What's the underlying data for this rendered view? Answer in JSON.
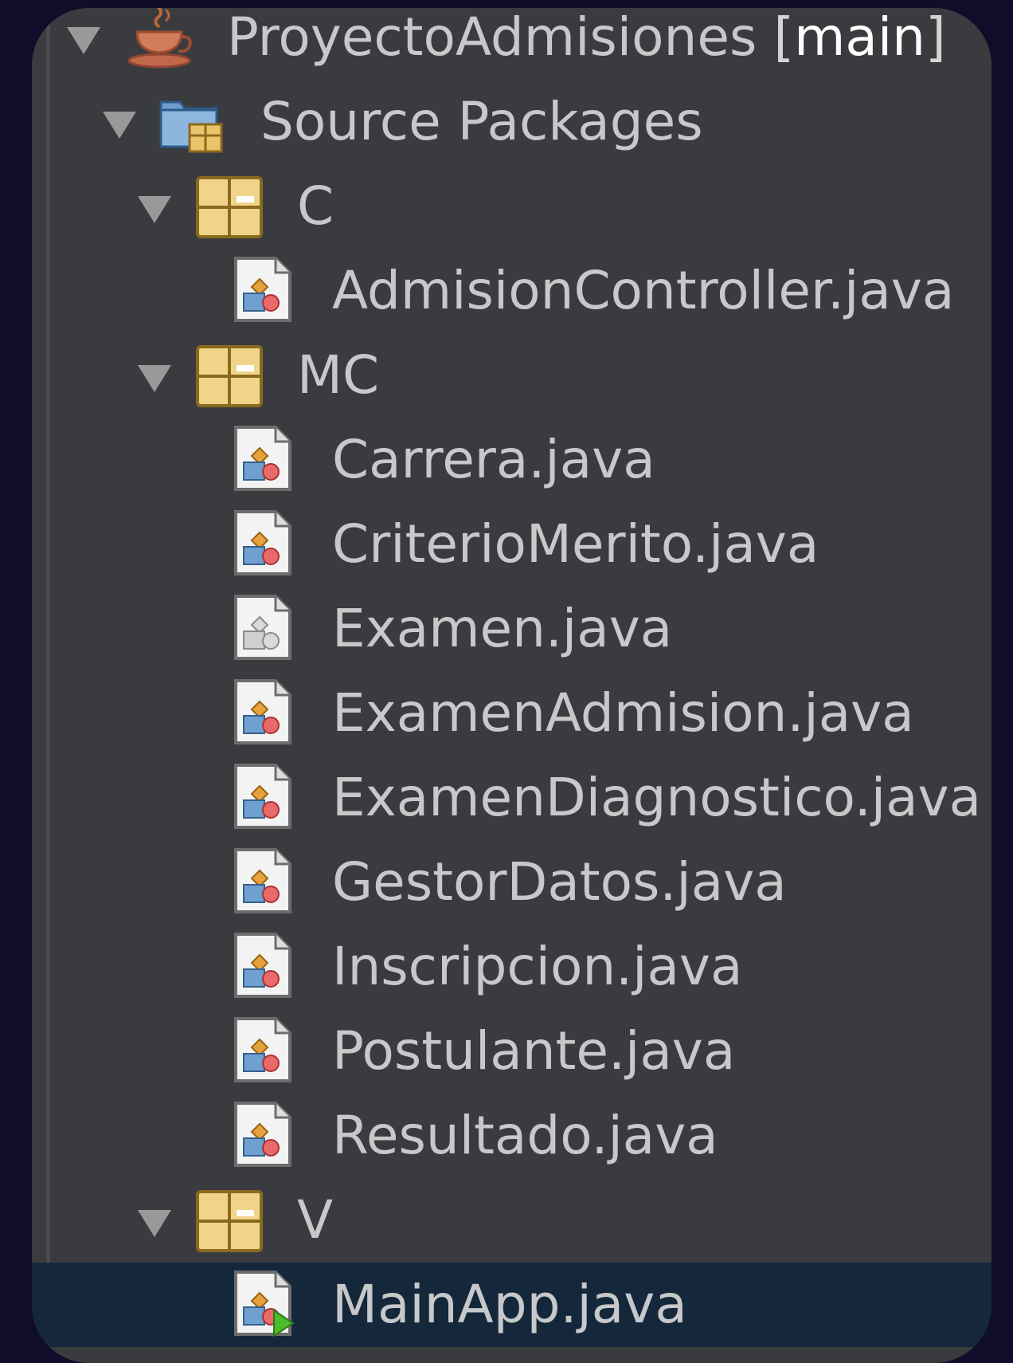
{
  "project": {
    "name": "ProyectoAdmisiones",
    "branch_open": "[",
    "branch": "main",
    "branch_close": "]",
    "icon": "coffee-cup-icon"
  },
  "source_packages": {
    "label": "Source Packages",
    "icon": "source-folder-icon"
  },
  "packages": [
    {
      "name": "C",
      "files": [
        "AdmisionController.java"
      ]
    },
    {
      "name": "MC",
      "files": [
        "Carrera.java",
        "CriterioMerito.java",
        "Examen.java",
        "ExamenAdmision.java",
        "ExamenDiagnostico.java",
        "GestorDatos.java",
        "Inscripcion.java",
        "Postulante.java",
        "Resultado.java"
      ]
    },
    {
      "name": "V",
      "files": [
        "MainApp.java"
      ]
    }
  ],
  "selected_file": "MainApp.java",
  "colors": {
    "panel": "#3a3b3e",
    "background": "#0f0d2a",
    "selection": "#14273b",
    "text": "#c7c8c9"
  }
}
